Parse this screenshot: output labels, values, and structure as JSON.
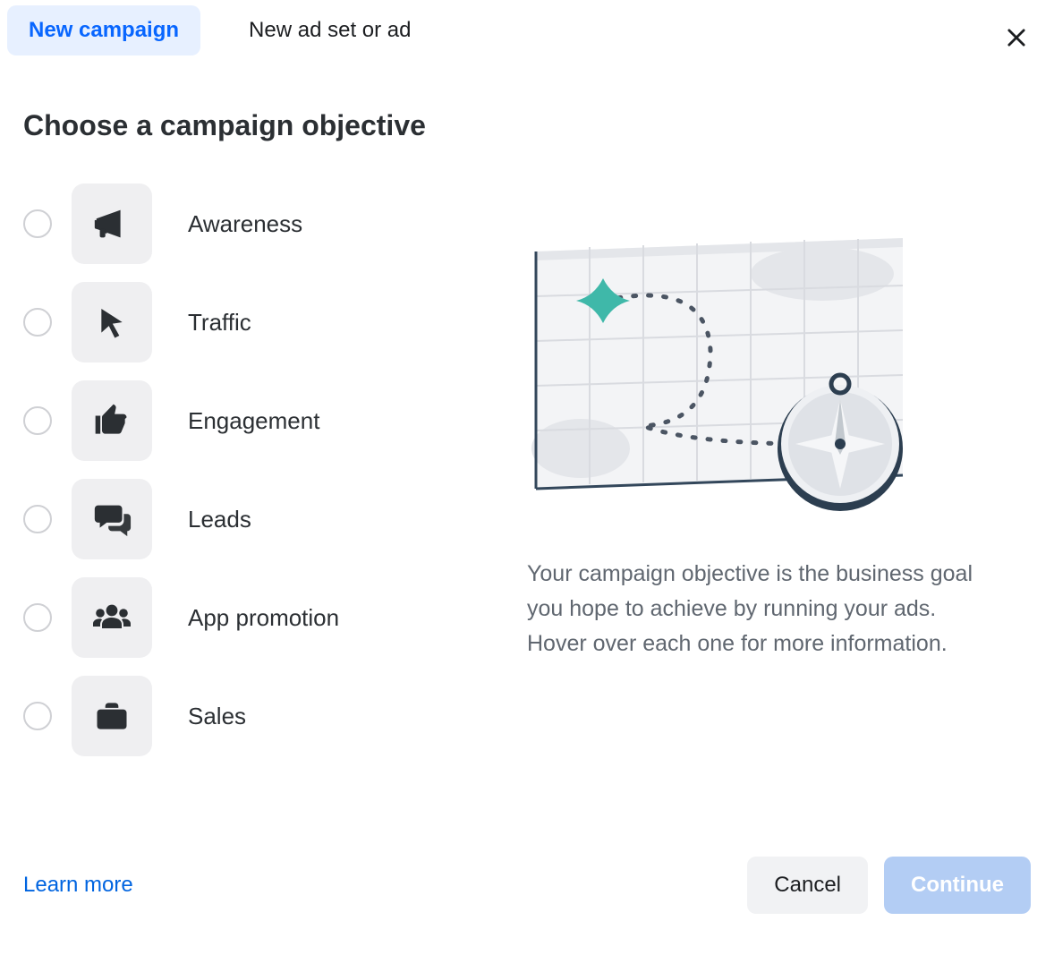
{
  "tabs": {
    "newCampaign": "New campaign",
    "newAdSetOrAd": "New ad set or ad"
  },
  "heading": "Choose a campaign objective",
  "objectives": [
    {
      "label": "Awareness"
    },
    {
      "label": "Traffic"
    },
    {
      "label": "Engagement"
    },
    {
      "label": "Leads"
    },
    {
      "label": "App promotion"
    },
    {
      "label": "Sales"
    }
  ],
  "description": "Your campaign objective is the business goal you hope to achieve by running your ads. Hover over each one for more information.",
  "footer": {
    "learnMore": "Learn more",
    "cancel": "Cancel",
    "continue": "Continue"
  }
}
